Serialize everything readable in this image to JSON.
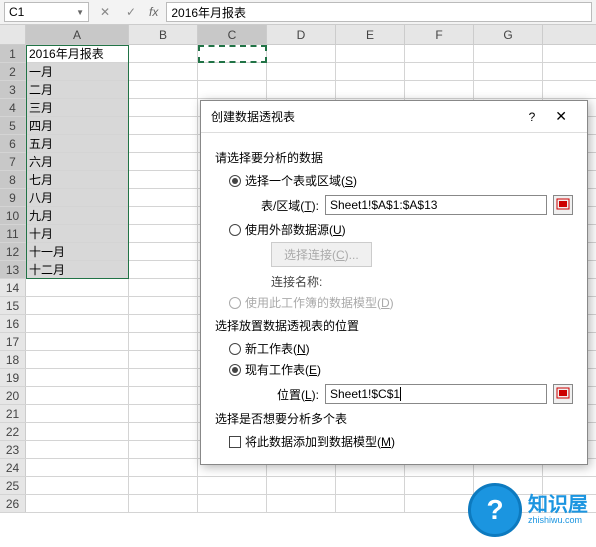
{
  "namebox": "C1",
  "formula": "2016年月报表",
  "cols": [
    "A",
    "B",
    "C",
    "D",
    "E",
    "F",
    "G"
  ],
  "rows": [
    "1",
    "2",
    "3",
    "4",
    "5",
    "6",
    "7",
    "8",
    "9",
    "10",
    "11",
    "12",
    "13",
    "14",
    "15",
    "16",
    "17",
    "18",
    "19",
    "20",
    "21",
    "22",
    "23",
    "24",
    "25",
    "26"
  ],
  "cells": {
    "a": [
      "2016年月报表",
      "一月",
      "二月",
      "三月",
      "四月",
      "五月",
      "六月",
      "七月",
      "八月",
      "九月",
      "十月",
      "十一月",
      "十二月"
    ]
  },
  "dialog": {
    "title": "创建数据透视表",
    "help": "?",
    "sect1": "请选择要分析的数据",
    "opt1": "选择一个表或区域(",
    "opt1u": "S",
    "opt1e": ")",
    "range_lbl": "表/区域(",
    "range_u": "T",
    "range_e": "):",
    "range_val": "Sheet1!$A$1:$A$13",
    "opt2": "使用外部数据源(",
    "opt2u": "U",
    "opt2e": ")",
    "conn_btn": "选择连接(",
    "conn_u": "C",
    "conn_e": ")...",
    "conn_name": "连接名称:",
    "opt3": "使用此工作簿的数据模型(",
    "opt3u": "D",
    "opt3e": ")",
    "sect2": "选择放置数据透视表的位置",
    "opt4": "新工作表(",
    "opt4u": "N",
    "opt4e": ")",
    "opt5": "现有工作表(",
    "opt5u": "E",
    "opt5e": ")",
    "loc_lbl": "位置(",
    "loc_u": "L",
    "loc_e": "):",
    "loc_val": "Sheet1!$C$1",
    "sect3": "选择是否想要分析多个表",
    "chk1": "将此数据添加到数据模型(",
    "chk1u": "M",
    "chk1e": ")"
  },
  "wm": {
    "name": "知识屋",
    "url": "zhishiwu.com"
  }
}
